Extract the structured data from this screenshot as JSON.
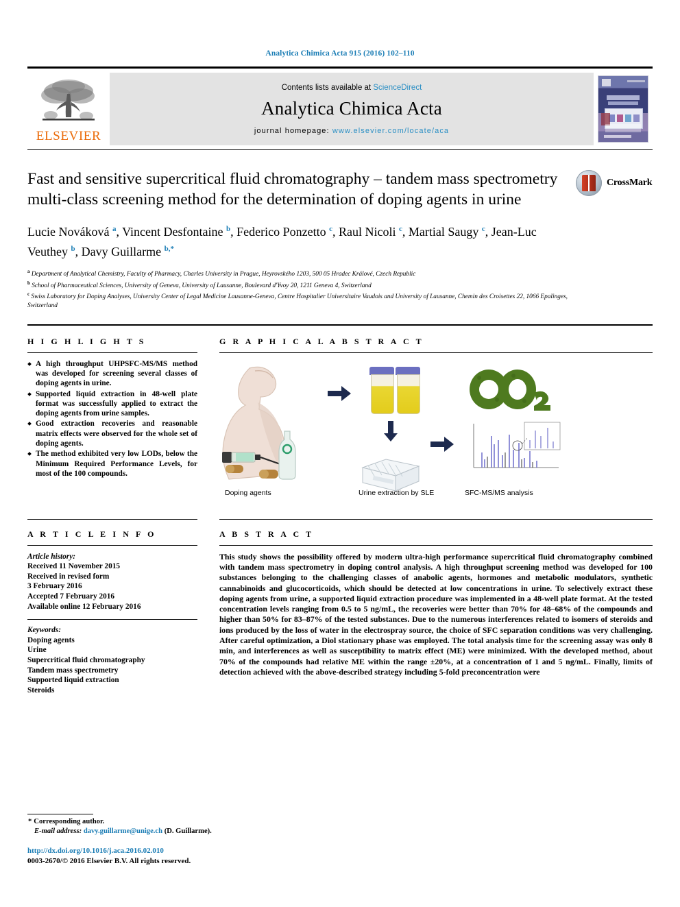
{
  "running_head": "Analytica Chimica Acta 915 (2016) 102–110",
  "masthead": {
    "publisher_name": "ELSEVIER",
    "contents_prefix": "Contents lists available at ",
    "contents_link": "ScienceDirect",
    "journal_title": "Analytica Chimica Acta",
    "homepage_prefix": "journal homepage: ",
    "homepage_url": "www.elsevier.com/locate/aca",
    "cover_alt": "journal-cover-thumbnail"
  },
  "article": {
    "title": "Fast and sensitive supercritical fluid chromatography – tandem mass spectrometry multi-class screening method for the determination of doping agents in urine",
    "crossmark_label": "CrossMark",
    "authors_html": "Lucie Nováková <sup>a</sup>, Vincent Desfontaine <sup>b</sup>, Federico Ponzetto <sup>c</sup>, Raul Nicoli <sup>c</sup>, Martial Saugy <sup>c</sup>, Jean-Luc Veuthey <sup>b</sup>, Davy Guillarme <sup>b,</sup><sup>*</sup>",
    "affiliations": [
      {
        "mark": "a",
        "text": "Department of Analytical Chemistry, Faculty of Pharmacy, Charles University in Prague, Heyrovského 1203, 500 05 Hradec Králové, Czech Republic"
      },
      {
        "mark": "b",
        "text": "School of Pharmaceutical Sciences, University of Geneva, University of Lausanne, Boulevard d'Yvoy 20, 1211 Geneva 4, Switzerland"
      },
      {
        "mark": "c",
        "text": "Swiss Laboratory for Doping Analyses, University Center of Legal Medicine Lausanne-Geneva, Centre Hospitalier Universitaire Vaudois and University of Lausanne, Chemin des Croisettes 22, 1066 Epalinges, Switzerland"
      }
    ]
  },
  "highlights": {
    "heading": "H I G H L I G H T S",
    "items": [
      "A high throughput UHPSFC-MS/MS method was developed for screening several classes of doping agents in urine.",
      "Supported liquid extraction in 48-well plate format was successfully applied to extract the doping agents from urine samples.",
      "Good extraction recoveries and reasonable matrix effects were observed for the whole set of doping agents.",
      "The method exhibited very low LODs, below the Minimum Required Performance Levels, for most of the 100 compounds."
    ]
  },
  "graphical_abstract": {
    "heading": "G R A P H I C A L   A B S T R A C T",
    "captions": [
      "Doping agents",
      "Urine extraction by SLE",
      "SFC-MS/MS analysis"
    ],
    "co2_label_main": "CO",
    "co2_label_sub": "2"
  },
  "article_info": {
    "heading": "A R T I C L E   I N F O",
    "history_label": "Article history:",
    "history": [
      "Received 11 November 2015",
      "Received in revised form",
      "3 February 2016",
      "Accepted 7 February 2016",
      "Available online 12 February 2016"
    ],
    "keywords_label": "Keywords:",
    "keywords": [
      "Doping agents",
      "Urine",
      "Supercritical fluid chromatography",
      "Tandem mass spectrometry",
      "Supported liquid extraction",
      "Steroids"
    ]
  },
  "abstract": {
    "heading": "A B S T R A C T",
    "text": "This study shows the possibility offered by modern ultra-high performance supercritical fluid chromatography combined with tandem mass spectrometry in doping control analysis. A high throughput screening method was developed for 100 substances belonging to the challenging classes of anabolic agents, hormones and metabolic modulators, synthetic cannabinoids and glucocorticoids, which should be detected at low concentrations in urine. To selectively extract these doping agents from urine, a supported liquid extraction procedure was implemented in a 48-well plate format. At the tested concentration levels ranging from 0.5 to 5 ng/mL, the recoveries were better than 70% for 48–68% of the compounds and higher than 50% for 83–87% of the tested substances. Due to the numerous interferences related to isomers of steroids and ions produced by the loss of water in the electrospray source, the choice of SFC separation conditions was very challenging. After careful optimization, a Diol stationary phase was employed. The total analysis time for the screening assay was only 8 min, and interferences as well as susceptibility to matrix effect (ME) were minimized. With the developed method, about 70% of the compounds had relative ME within the range ±20%, at a concentration of 1 and 5 ng/mL. Finally, limits of detection achieved with the above-described strategy including 5-fold preconcentration were"
  },
  "footer": {
    "corresponding_star": "*",
    "corresponding_label": "Corresponding author.",
    "email_label": "E-mail address:",
    "email": "davy.guillarme@unige.ch",
    "email_suffix": "(D. Guillarme).",
    "doi": "http://dx.doi.org/10.1016/j.aca.2016.02.010",
    "copyright": "0003-2670/© 2016 Elsevier B.V. All rights reserved."
  },
  "colors": {
    "link_blue": "#1b7db5",
    "elsevier_orange": "#eb6c0b",
    "band_grey": "#e3e3e3"
  }
}
